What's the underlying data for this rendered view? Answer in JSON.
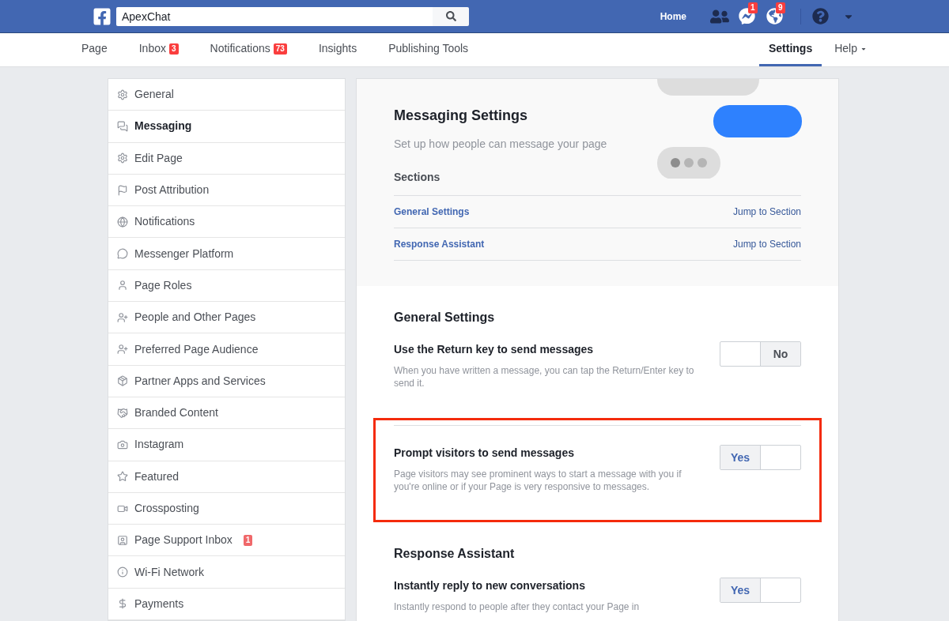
{
  "topbar": {
    "search": {
      "value": "ApexChat"
    },
    "home": "Home",
    "badges": [
      {
        "kind": "messenger",
        "count": "1"
      },
      {
        "kind": "globe",
        "count": "9"
      }
    ]
  },
  "tabs": [
    {
      "label": "Page",
      "selected": false
    },
    {
      "label": "Inbox",
      "badge": "3",
      "selected": false
    },
    {
      "label": "Notifications",
      "badge": "73",
      "selected": false
    },
    {
      "label": "Insights",
      "selected": false
    },
    {
      "label": "Publishing Tools",
      "selected": false
    }
  ],
  "right_tabs": [
    {
      "label": "Settings",
      "selected": true,
      "dropdown": false
    },
    {
      "label": "Help",
      "selected": false,
      "dropdown": true
    }
  ],
  "sidebar": {
    "items": [
      {
        "label": "General",
        "selected": false
      },
      {
        "label": "Messaging",
        "selected": true
      },
      {
        "label": "Edit Page",
        "selected": false
      },
      {
        "label": "Post Attribution",
        "selected": false
      },
      {
        "label": "Notifications",
        "selected": false
      },
      {
        "label": "Messenger Platform",
        "selected": false
      },
      {
        "label": "Page Roles",
        "selected": false
      },
      {
        "label": "People and Other Pages",
        "selected": false
      },
      {
        "label": "Preferred Page Audience",
        "selected": false
      },
      {
        "label": "Partner Apps and Services",
        "selected": false
      },
      {
        "label": "Branded Content",
        "selected": false
      },
      {
        "label": "Instagram",
        "selected": false
      },
      {
        "label": "Featured",
        "selected": false
      },
      {
        "label": "Crossposting",
        "selected": false
      },
      {
        "label": "Page Support Inbox",
        "selected": false,
        "badge": "1"
      },
      {
        "label": "Wi-Fi Network",
        "selected": false
      },
      {
        "label": "Payments",
        "selected": false
      }
    ]
  },
  "header": {
    "title": "Messaging Settings",
    "subtitle": "Set up how people can message your page",
    "sections_title": "Sections",
    "sections": [
      {
        "label": "General Settings",
        "action": "Jump to Section"
      },
      {
        "label": "Response Assistant",
        "action": "Jump to Section"
      }
    ]
  },
  "groups": [
    {
      "title": "General Settings",
      "settings": [
        {
          "title": "Use the Return key to send messages",
          "description": "When you have written a message, you can tap the Return/Enter key to send it.",
          "on": false,
          "toggle_label": "No",
          "highlighted": false
        },
        {
          "title": "Prompt visitors to send messages",
          "description": "Page visitors may see prominent ways to start a message with you if you're online or if your Page is very responsive to messages.",
          "on": true,
          "toggle_label": "Yes",
          "highlighted": true
        }
      ]
    },
    {
      "title": "Response Assistant",
      "settings": [
        {
          "title": "Instantly reply to new conversations",
          "description": "Instantly respond to people after they contact your Page in",
          "on": true,
          "toggle_label": "Yes",
          "highlighted": false
        }
      ]
    }
  ]
}
